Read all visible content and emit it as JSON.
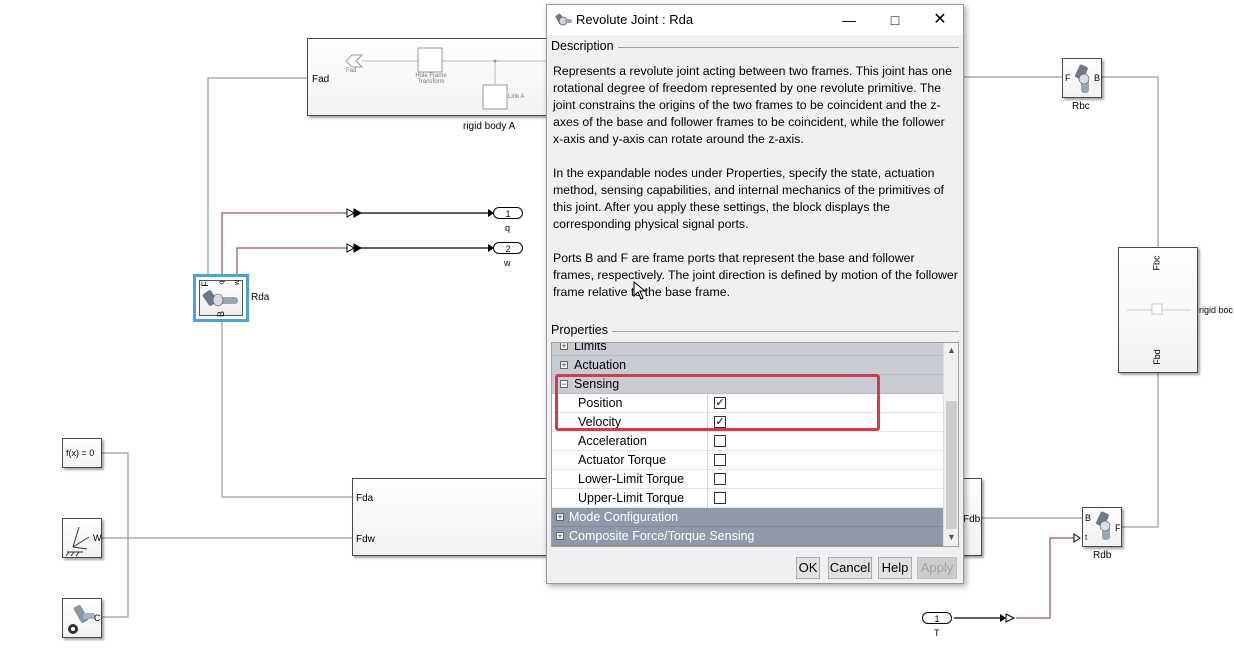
{
  "dialog": {
    "title": "Revolute Joint : Rda",
    "description_header": "Description",
    "description_paragraphs": [
      "Represents a revolute joint acting between two frames. This joint has one rotational degree of freedom represented by one revolute primitive. The joint constrains the origins of the two frames to be coincident and the z-axes of the base and follower frames to be coincident, while the follower x-axis and y-axis can rotate around the z-axis.",
      "In the expandable nodes under Properties, specify the state, actuation method, sensing capabilities, and internal mechanics of the primitives of this joint. After you apply these settings, the block displays the corresponding physical signal ports.",
      "Ports B and F are frame ports that represent the base and follower frames, respectively. The joint direction is defined by motion of the follower frame relative to the base frame."
    ],
    "properties_header": "Properties",
    "groups": {
      "limits": "Limits",
      "actuation": "Actuation",
      "sensing": "Sensing",
      "mode": "Mode Configuration",
      "composite": "Composite Force/Torque Sensing"
    },
    "sensing_items": [
      {
        "label": "Position",
        "checked": true
      },
      {
        "label": "Velocity",
        "checked": true
      },
      {
        "label": "Acceleration",
        "checked": false
      },
      {
        "label": "Actuator Torque",
        "checked": false
      },
      {
        "label": "Lower-Limit Torque",
        "checked": false
      },
      {
        "label": "Upper-Limit Torque",
        "checked": false
      }
    ],
    "buttons": {
      "ok": "OK",
      "cancel": "Cancel",
      "help": "Help",
      "apply": "Apply"
    },
    "highlight_color": "#d93a4a"
  },
  "diagram": {
    "rigid_body_a": {
      "label": "rigid body A",
      "port_fad": "Fad",
      "inner_fad": "Fad",
      "hole_frame": "Hole Frame Transform",
      "link_a": "Link A"
    },
    "rda": {
      "label": "Rda",
      "port_f": "F",
      "port_q": "q",
      "port_w": "w",
      "port_b": "B"
    },
    "outports": [
      {
        "num": "1",
        "label": "q"
      },
      {
        "num": "2",
        "label": "w"
      }
    ],
    "rbc": {
      "label": "Rbc",
      "port_f": "F",
      "port_b": "B"
    },
    "right_body": {
      "label": "rigid boc",
      "port_fbc": "Fbc",
      "port_fbd": "Fbd"
    },
    "bottom_body": {
      "port_fda": "Fda",
      "port_fdw": "Fdw",
      "port_fdb": "Fdb"
    },
    "rdb": {
      "label": "Rdb",
      "port_b": "B",
      "port_t": "t",
      "port_f": "F"
    },
    "solver": {
      "label": "f(x) = 0"
    },
    "world": {
      "port_w": "W"
    },
    "config": {
      "port_c": "C"
    },
    "inport_t": {
      "num": "1",
      "label": "T"
    }
  }
}
